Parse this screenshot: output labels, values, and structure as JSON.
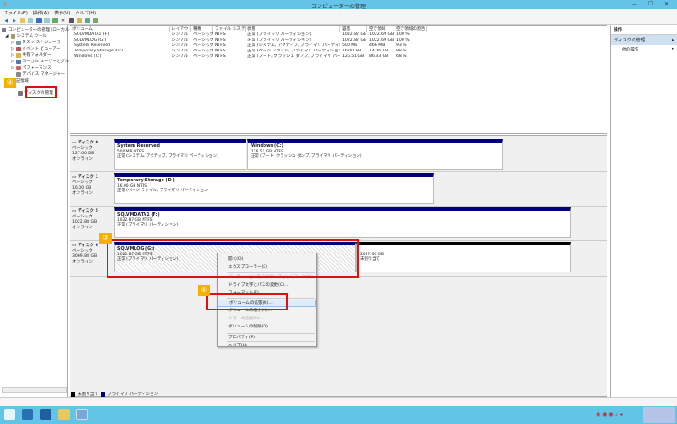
{
  "window": {
    "title": "コンピューターの管理",
    "controls": [
      "—",
      "☐",
      "✕"
    ]
  },
  "menu": [
    "ファイル(F)",
    "操作(A)",
    "表示(V)",
    "ヘルプ(H)"
  ],
  "tree": [
    {
      "label": "コンピューターの管理 (ローカル)",
      "indent": 0
    },
    {
      "label": "システム ツール",
      "indent": 1
    },
    {
      "label": "タスク スケジューラ",
      "indent": 2
    },
    {
      "label": "イベント ビューアー",
      "indent": 2
    },
    {
      "label": "共有フォルダー",
      "indent": 2
    },
    {
      "label": "ローカル ユーザーとグループ",
      "indent": 2
    },
    {
      "label": "パフォーマンス",
      "indent": 2
    },
    {
      "label": "デバイス マネージャー",
      "indent": 2
    },
    {
      "label": "記憶域",
      "indent": 1
    },
    {
      "label": "バック",
      "indent": 2
    },
    {
      "label": "ディスクの管理",
      "indent": 2
    }
  ],
  "volume_list": {
    "columns": [
      "ボリューム",
      "レイアウト",
      "種類",
      "ファイル システム",
      "状態",
      "容量",
      "空き領域",
      "空き領域の割合"
    ],
    "rows": [
      [
        "SQLVMDATA1 (F:)",
        "シンプル",
        "ベーシック",
        "NTFS",
        "正常 (プライマリ パーティション)",
        "1022.87 GB",
        "1022.69 GB",
        "100 %"
      ],
      [
        "SQLVMLOG (G:)",
        "シンプル",
        "ベーシック",
        "NTFS",
        "正常 (プライマリ パーティション)",
        "1022.87 GB",
        "1022.69 GB",
        "100 %"
      ],
      [
        "System Reserved",
        "シンプル",
        "ベーシック",
        "NTFS",
        "正常 (システム, アクティブ, プライマリ パーティション)",
        "500 MB",
        "466 MB",
        "93 %"
      ],
      [
        "Temporary Storage (D:)",
        "シンプル",
        "ベーシック",
        "NTFS",
        "正常 (ページ ファイル, プライマリ パーティション)",
        "16.00 GB",
        "14.06 GB",
        "88 %"
      ],
      [
        "Windows (C:)",
        "シンプル",
        "ベーシック",
        "NTFS",
        "正常 (ブート, クラッシュ ダンプ, プライマリ パーティション)",
        "126.51 GB",
        "86.33 GB",
        "68 %"
      ]
    ]
  },
  "disks": [
    {
      "name": "ディスク 0",
      "type": "ベーシック",
      "size": "127.00 GB",
      "status": "オンライン",
      "parts": [
        {
          "name": "System Reserved",
          "size": "500 MB NTFS",
          "status": "正常 (システム, アクティブ, プライマリ パーティション)"
        },
        {
          "name": "Windows (C:)",
          "size": "126.51 GB NTFS",
          "status": "正常 (ブート, クラッシュ ダンプ, プライマリ パーティション)"
        }
      ]
    },
    {
      "name": "ディスク 1",
      "type": "ベーシック",
      "size": "16.00 GB",
      "status": "オンライン",
      "parts": [
        {
          "name": "Temporary Storage (D:)",
          "size": "16.00 GB NTFS",
          "status": "正常 (ページ ファイル, プライマリ パーティション)"
        }
      ]
    },
    {
      "name": "ディスク 5",
      "type": "ベーシック",
      "size": "1022.88 GB",
      "status": "オンライン",
      "parts": [
        {
          "name": "SQLVMDATA1 (F:)",
          "size": "1022.87 GB NTFS",
          "status": "正常 (プライマリ パーティション)"
        }
      ]
    },
    {
      "name": "ディスク 6",
      "type": "ベーシック",
      "size": "3069.88 GB",
      "status": "オンライン",
      "parts": [
        {
          "name": "SQLVMLOG (G:)",
          "size": "1022.87 GB NTFS",
          "status": "正常 (プライマリ パーティション)"
        },
        {
          "name": "",
          "size": "2047.00 GB",
          "status": "未割り当て"
        }
      ]
    }
  ],
  "legend": [
    "未割り当て",
    "プライマリ パーティション"
  ],
  "context_menu": [
    {
      "label": "開く(O)",
      "disabled": false
    },
    {
      "label": "エクスプローラー(E)",
      "disabled": false
    },
    {
      "label": "パーティションをアクティブとしてマーク(M)",
      "disabled": true
    },
    {
      "label": "ドライブ文字とパスの変更(C)...",
      "disabled": false
    },
    {
      "label": "フォーマット(F)...",
      "disabled": false
    },
    {
      "label": "ボリュームの拡張(X)...",
      "disabled": false,
      "highlighted": true
    },
    {
      "label": "ボリュームの縮小(H)...",
      "disabled": false
    },
    {
      "label": "ミラーの追加(A)...",
      "disabled": true
    },
    {
      "label": "ボリュームの削除(D)...",
      "disabled": false
    },
    {
      "label": "プロパティ(P)",
      "disabled": false
    },
    {
      "label": "ヘルプ(H)",
      "disabled": false
    }
  ],
  "actions": {
    "header": "操作",
    "section": "ディスクの管理",
    "item": "他の操作"
  },
  "annotations": [
    "④",
    "⑤",
    "⑥"
  ],
  "colors": {
    "primary_partition": "#00007a",
    "unallocated": "#000000",
    "annotation": "#f5b000",
    "highlight_box": "#e01010",
    "taskbar": "#62c4e6"
  }
}
